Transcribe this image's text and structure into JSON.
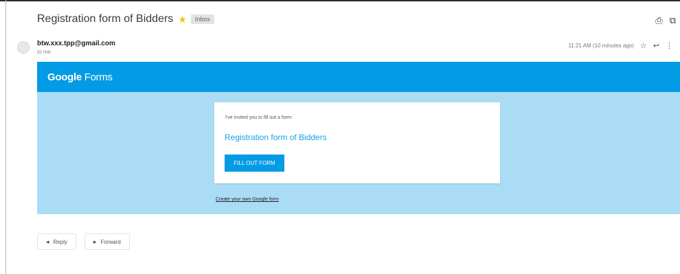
{
  "email": {
    "subject": "Registration form of Bidders",
    "label": "Inbox",
    "sender_email": "btw.xxx.tpp@gmail.com",
    "recipient": "to me",
    "timestamp": "11:21 AM (10 minutes ago)"
  },
  "icons": {
    "star": "★",
    "print": "⎙",
    "popout": "⧉",
    "reply_small": "↩",
    "more": "⋮",
    "star_meta": "☆"
  },
  "google_forms": {
    "brand_google": "Google",
    "brand_forms": "Forms",
    "invite_text": "I've invited you to fill out a form:",
    "form_title": "Registration form of Bidders",
    "fill_button": "FILL OUT FORM",
    "footer_link": "Create your own Google form"
  },
  "actions": {
    "reply": "Reply",
    "forward": "Forward"
  },
  "colors": {
    "header_blue": "#039be5",
    "body_light_blue": "#abdcf6",
    "title_blue": "#1aa0e6"
  }
}
